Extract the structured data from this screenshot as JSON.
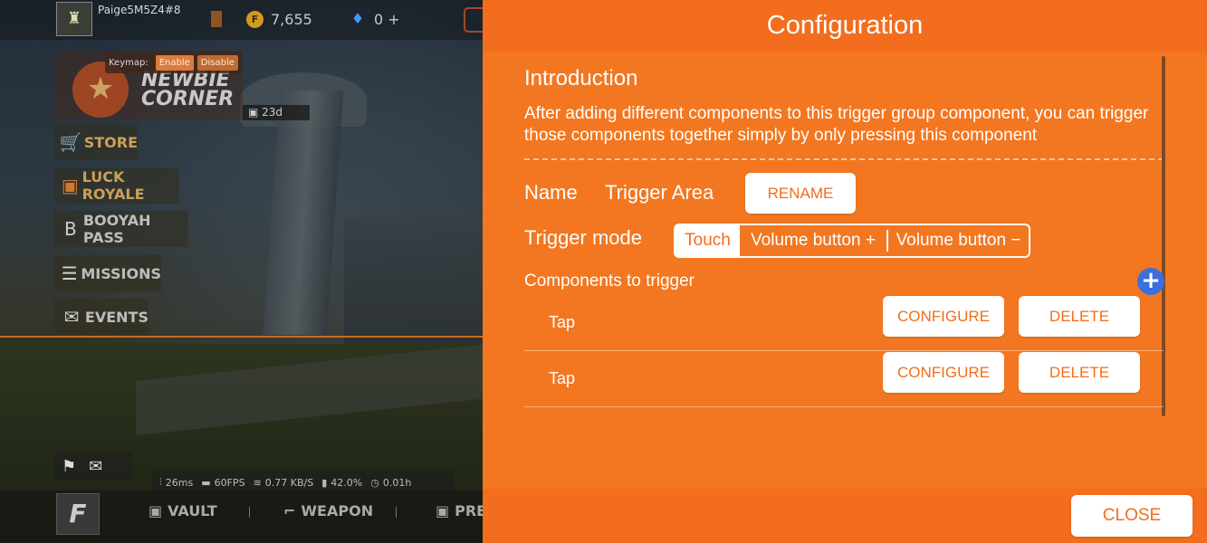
{
  "game": {
    "player_name": "Paige5M5Z4#8",
    "gold_count": "7,655",
    "diamond_count": "0 +",
    "newbie_title": "NEWBIE CORNER",
    "keymap": {
      "label": "Keymap:",
      "enable": "Enable",
      "disable": "Disable"
    },
    "event_timer": "23d",
    "menu": [
      {
        "label": "STORE",
        "icon": "cart-icon"
      },
      {
        "label": "LUCK ROYALE",
        "icon": "treasure-icon"
      },
      {
        "label": "BOOYAH PASS",
        "icon": "booyah-icon"
      },
      {
        "label": "MISSIONS",
        "icon": "clipboard-icon"
      },
      {
        "label": "EVENTS",
        "icon": "mail-icon"
      }
    ],
    "stats": {
      "ping": "26ms",
      "fps": "60FPS",
      "network": "0.77 KB/S",
      "battery": "42.0%",
      "time": "0.01h"
    },
    "bottom_nav": {
      "vault": "VAULT",
      "weapon": "WEAPON",
      "pres": "PRES"
    }
  },
  "config": {
    "title": "Configuration",
    "intro_title": "Introduction",
    "intro_text": "After adding different components to this trigger group component, you can trigger those components together simply by only pressing this component",
    "name_label": "Name",
    "name_value": "Trigger Area",
    "rename_label": "RENAME",
    "trigger_mode_label": "Trigger mode",
    "trigger_modes": [
      "Touch",
      "Volume button +",
      "Volume button −"
    ],
    "trigger_mode_selected": "Touch",
    "components_title": "Components to trigger",
    "add_label": "+",
    "components": [
      {
        "name": "Tap",
        "configure": "CONFIGURE",
        "delete": "DELETE"
      },
      {
        "name": "Tap",
        "configure": "CONFIGURE",
        "delete": "DELETE"
      }
    ],
    "close_label": "CLOSE"
  },
  "colors": {
    "panel_bg": "#f37720",
    "panel_header": "#f26d1d",
    "button_text": "#f26d1d",
    "add_button": "#3b6fe0"
  }
}
